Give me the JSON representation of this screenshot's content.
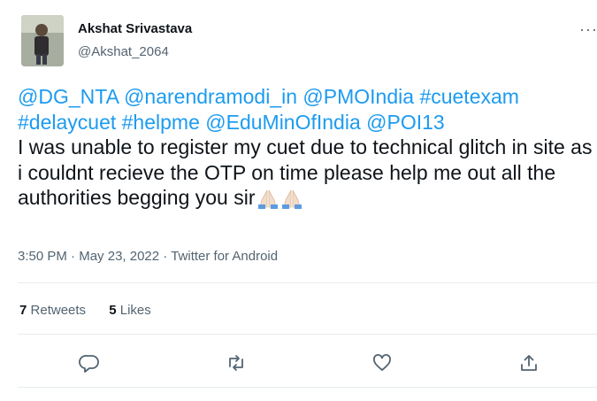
{
  "author": {
    "name": "Akshat Srivastava",
    "handle": "@Akshat_2064"
  },
  "tweet": {
    "segments": [
      {
        "text": "@DG_NTA",
        "type": "link"
      },
      {
        "text": " ",
        "type": "text"
      },
      {
        "text": "@narendramodi_in",
        "type": "link"
      },
      {
        "text": " ",
        "type": "text"
      },
      {
        "text": "@PMOIndia",
        "type": "link"
      },
      {
        "text": " ",
        "type": "text"
      },
      {
        "text": "#cuetexam",
        "type": "link"
      },
      {
        "text": " ",
        "type": "text"
      },
      {
        "text": "#delaycuet",
        "type": "link"
      },
      {
        "text": " ",
        "type": "text"
      },
      {
        "text": "#helpme",
        "type": "link"
      },
      {
        "text": " ",
        "type": "text"
      },
      {
        "text": "@EduMinOfIndia",
        "type": "link"
      },
      {
        "text": " ",
        "type": "text"
      },
      {
        "text": "@POI13",
        "type": "link"
      },
      {
        "text": "I was unable to register my cuet due to technical glitch in site as i couldnt recieve the OTP on time please help me out all the authorities begging you sir",
        "type": "text"
      }
    ],
    "emoji": [
      "folded-hands",
      "folded-hands"
    ],
    "link_color": "#1d9bf0"
  },
  "meta": {
    "time": "3:50 PM",
    "date": "May 23, 2022",
    "source": "Twitter for Android",
    "separator": "·"
  },
  "stats": {
    "retweets_count": "7",
    "retweets_label": "Retweets",
    "likes_count": "5",
    "likes_label": "Likes"
  },
  "actions": [
    "reply-icon",
    "retweet-icon",
    "like-icon",
    "share-icon"
  ],
  "more_glyph": "···"
}
